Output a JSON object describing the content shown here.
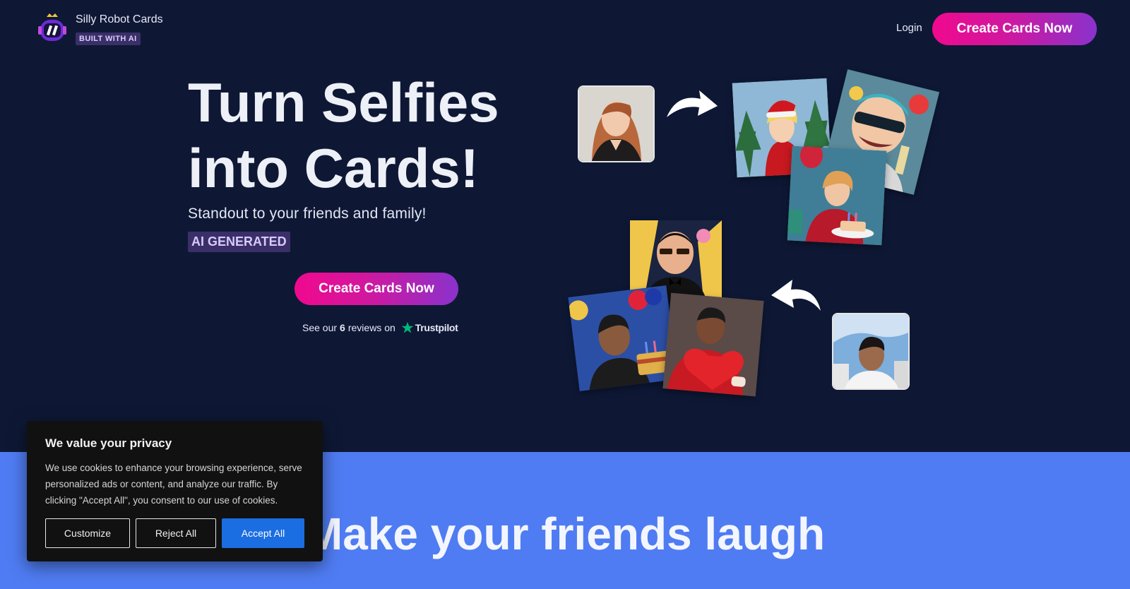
{
  "header": {
    "brand_name": "Silly Robot Cards",
    "brand_badge": "BUILT WITH AI",
    "login": "Login",
    "cta": "Create Cards Now"
  },
  "hero": {
    "title_line1": "Turn Selfies",
    "title_line2": "into Cards!",
    "subtitle": "Standout to your friends and family!",
    "tag": "AI GENERATED",
    "cta": "Create Cards Now",
    "reviews_prefix": "See our",
    "reviews_count": "6",
    "reviews_suffix": "reviews on",
    "trustpilot": "Trustpilot"
  },
  "section2": {
    "title": "Make your friends laugh"
  },
  "cookie": {
    "title": "We value your privacy",
    "text": "We use cookies to enhance your browsing experience, serve personalized ads or content, and analyze our traffic. By clicking \"Accept All\", you consent to our use of cookies.",
    "customize": "Customize",
    "reject": "Reject All",
    "accept": "Accept All"
  },
  "colors": {
    "background": "#0e1835",
    "accent_pink": "#f0098e",
    "accent_purple": "#8a32cc",
    "section_blue": "#4f7cf2",
    "accept_blue": "#1b6de2",
    "trustpilot_green": "#00b67a"
  },
  "icons": {
    "logo": "robot-logo-icon",
    "arrow_right": "curved-arrow-right-icon",
    "arrow_left": "curved-arrow-left-icon",
    "trustpilot_star": "star-icon"
  }
}
